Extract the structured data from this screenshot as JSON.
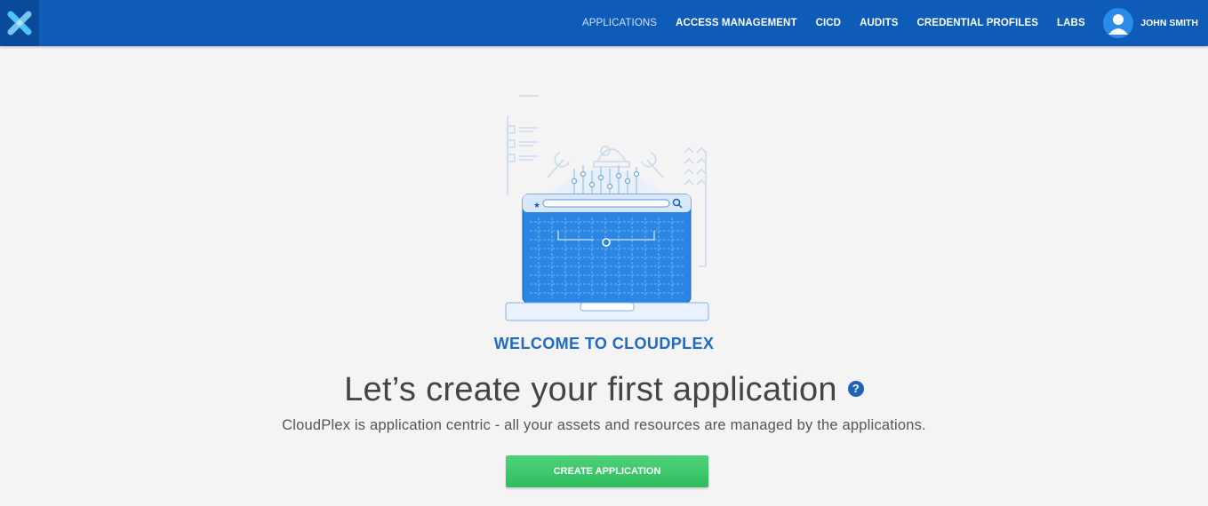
{
  "header": {
    "logo_icon": "cloudplex-x-logo",
    "nav": [
      {
        "label": "APPLICATIONS",
        "active": true
      },
      {
        "label": "ACCESS MANAGEMENT"
      },
      {
        "label": "CICD"
      },
      {
        "label": "AUDITS"
      },
      {
        "label": "CREDENTIAL PROFILES"
      },
      {
        "label": "LABS"
      }
    ],
    "user": {
      "name": "JOHN SMITH",
      "icon": "user-avatar-icon"
    }
  },
  "main": {
    "illustration_icon": "laptop-dashboard-illustration",
    "welcome": "WELCOME TO CLOUDPLEX",
    "headline": "Let’s create your first application",
    "help_icon": "?",
    "subtitle": "CloudPlex is application centric - all your assets and resources are managed by the applications.",
    "cta_label": "CREATE APPLICATION"
  },
  "colors": {
    "header_bg": "#0f5bb8",
    "accent_blue": "#1f6bc4",
    "button_green": "#3cc86a",
    "page_bg": "#f4f4f4"
  }
}
